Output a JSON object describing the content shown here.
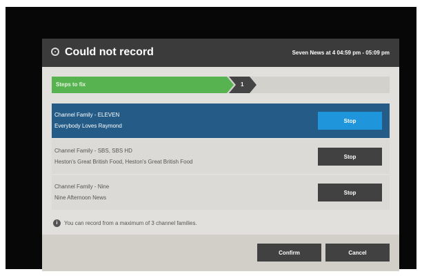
{
  "dialog": {
    "title": "Could not record",
    "program_info": "Seven News at 4 04:59 pm - 05:09 pm",
    "title_icon": "record-icon"
  },
  "steps": {
    "label": "Steps to fix",
    "current_step": "1"
  },
  "channel_families": [
    {
      "family": "Channel Family - ELEVEN",
      "programs": "Everybody Loves Raymond",
      "button": "Stop"
    },
    {
      "family": "Channel Family - SBS, SBS HD",
      "programs": "Heston's Great British Food, Heston's Great British Food",
      "button": "Stop"
    },
    {
      "family": "Channel Family - Nine",
      "programs": "Nine Afternoon News",
      "button": "Stop"
    }
  ],
  "info": {
    "icon": "info-icon",
    "text": "You can record from a maximum of 3 channel families."
  },
  "footer": {
    "confirm_label": "Confirm",
    "cancel_label": "Cancel"
  },
  "colors": {
    "header_bg": "#3b3b3b",
    "step_green": "#56b34f",
    "selected_row": "#245c87",
    "selected_button": "#1f95dc",
    "button_dark": "#414141"
  }
}
